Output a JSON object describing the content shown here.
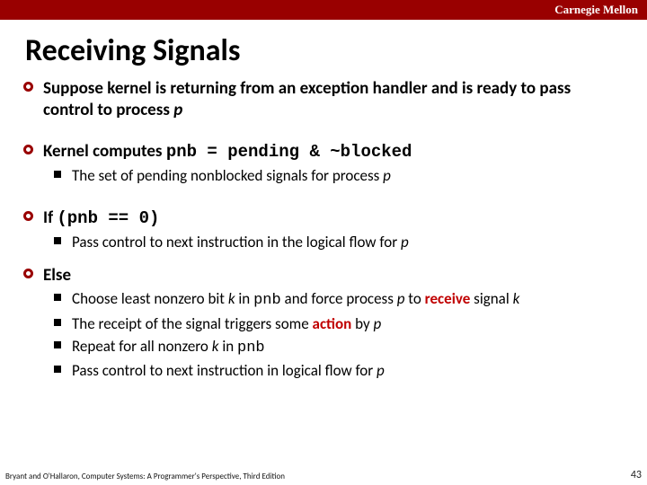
{
  "header": {
    "institution": "Carnegie Mellon"
  },
  "title": "Receiving Signals",
  "bullets": {
    "b1_a": "Suppose kernel is returning from an exception handler and is ready to pass control to process ",
    "b1_p": "p",
    "b2_a": "Kernel computes ",
    "b2_code": "pnb = pending & ~blocked",
    "b2s1_a": "The set of pending nonblocked signals for process ",
    "b2s1_p": "p",
    "b3_a": "If ",
    "b3_code": "(pnb == 0)",
    "b3s1_a": "Pass control to next instruction in the logical flow for ",
    "b3s1_p": "p",
    "b4": "Else",
    "b4s1_a": "Choose least nonzero bit ",
    "b4s1_k": "k",
    "b4s1_b": " in ",
    "b4s1_code": "pnb",
    "b4s1_c": " and force process ",
    "b4s1_p": "p",
    "b4s1_d": " to ",
    "b4s1_recv": "receive",
    "b4s1_e": " signal ",
    "b4s1_k2": "k",
    "b4s2_a": "The receipt of the signal triggers some ",
    "b4s2_act": "action",
    "b4s2_b": " by ",
    "b4s2_p": "p",
    "b4s3_a": "Repeat for all nonzero ",
    "b4s3_k": "k",
    "b4s3_b": " in ",
    "b4s3_code": "pnb",
    "b4s4_a": "Pass control to next instruction in logical flow for ",
    "b4s4_p": "p"
  },
  "footer": {
    "attribution": "Bryant and O'Hallaron, Computer Systems: A Programmer's Perspective, Third Edition",
    "page": "43"
  }
}
